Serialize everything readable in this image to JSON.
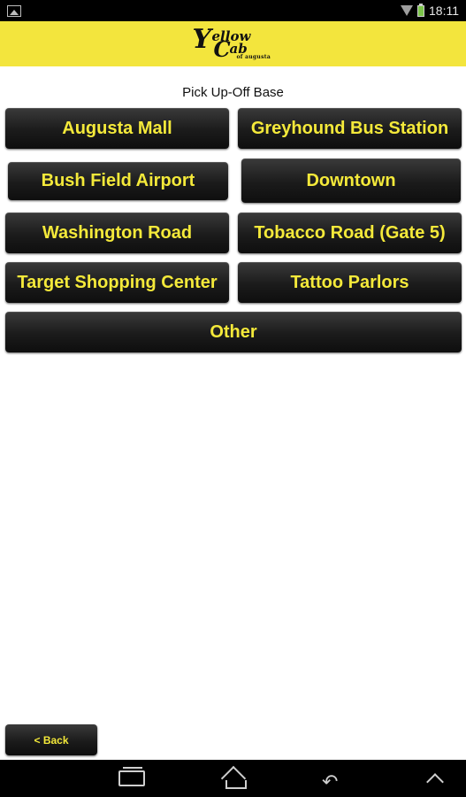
{
  "status_bar": {
    "time": "18:11"
  },
  "header": {
    "logo_lines": [
      "Y",
      "ellow",
      "C",
      "ab",
      "of augusta"
    ]
  },
  "main": {
    "title": "Pick Up-Off Base",
    "locations": [
      "Augusta Mall",
      "Greyhound Bus Station",
      "Bush Field Airport",
      "Downtown",
      "Washington Road",
      "Tobacco Road (Gate 5)",
      "Target Shopping Center",
      "Tattoo Parlors",
      "Other"
    ]
  },
  "footer": {
    "back_label": "< Back"
  },
  "nav_bar": {
    "icons": [
      "recents-icon",
      "home-icon",
      "back-icon",
      "up-icon"
    ]
  },
  "colors": {
    "header_bg": "#f3e53d",
    "button_text": "#f4e93a",
    "button_bg": "#1b1b1b"
  }
}
